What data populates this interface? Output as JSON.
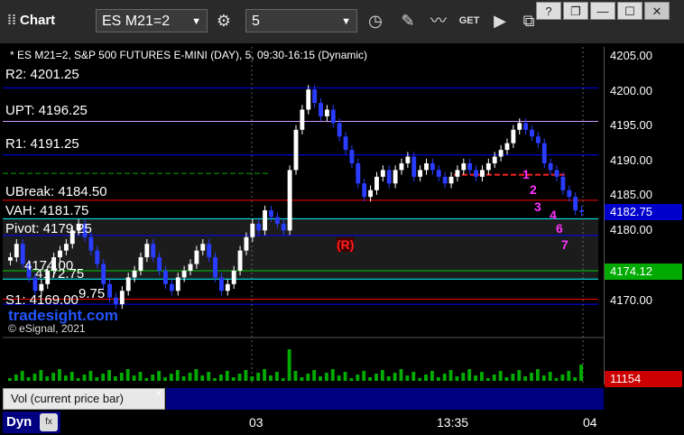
{
  "toolbar": {
    "app_title": "Chart",
    "symbol": "ES M21=2",
    "interval": "5",
    "win_help": "?",
    "win_restore": "❐",
    "win_minimize": "—",
    "win_maximize": "☐",
    "win_close": "✕"
  },
  "chart": {
    "header": "* ES M21=2, S&P 500 FUTURES E-MINI (DAY), 5, 09:30-16:15 (Dynamic)",
    "levels": [
      {
        "label": "R2: 4201.25",
        "color": "#0000ff"
      },
      {
        "label": "UPT: 4196.25",
        "color": "#cc99ff"
      },
      {
        "label": "R1: 4191.25",
        "color": "#0000ff"
      },
      {
        "label": "UBreak: 4184.50",
        "color": "#ff0000"
      },
      {
        "label": "VAH: 4181.75",
        "color": "#00ffff"
      },
      {
        "label": "Pivot: 4179.25",
        "color": "#0000ff"
      },
      {
        "label": "4174.00",
        "color": "#00cc00"
      },
      {
        "label": "4172.75",
        "color": "#00ffff"
      },
      {
        "label": "9.75",
        "color": "#ff0000"
      },
      {
        "label": "S1: 4169.00",
        "color": "#0000ff"
      }
    ],
    "brand": "tradesight.com",
    "copyright": "© eSignal, 2021",
    "r_marker": "(R)",
    "seq_magenta": [
      "1",
      "2",
      "3",
      "4",
      "6",
      "7"
    ]
  },
  "axis": {
    "ticks": [
      "4205.00",
      "4200.00",
      "4195.00",
      "4190.00",
      "4185.00",
      "4180.00",
      "4170.00"
    ],
    "last_price": "4182.75",
    "green_price": "4174.12",
    "volume": "11154"
  },
  "volume_panel": {
    "label": "Vol (current price bar)",
    "close": "×"
  },
  "bottom": {
    "dyn": "Dyn",
    "times": [
      "03",
      "13:35",
      "04"
    ]
  },
  "colors": {
    "up_bar": "#ffffff",
    "down_bar": "#2a3cff",
    "green": "#00cc00",
    "magenta": "#ff33ff"
  },
  "chart_data": {
    "type": "candlestick",
    "title": "* ES M21=2, S&P 500 FUTURES E-MINI (DAY), 5, 09:30-16:15 (Dynamic)",
    "ylim": [
      4167,
      4206
    ],
    "close_series": [
      4176,
      4178,
      4175,
      4173,
      4171,
      4172,
      4174,
      4176,
      4177,
      4178,
      4180,
      4181,
      4179,
      4177,
      4175,
      4172,
      4170,
      4169,
      4171,
      4173,
      4174,
      4176,
      4178,
      4176,
      4174,
      4172,
      4171,
      4173,
      4174,
      4175,
      4177,
      4178,
      4176,
      4173,
      4171,
      4172,
      4174,
      4177,
      4179,
      4181,
      4180,
      4183,
      4182,
      4181,
      4180,
      4189,
      4195,
      4198,
      4201,
      4199,
      4197,
      4198,
      4196,
      4194,
      4192,
      4190,
      4187,
      4185,
      4186,
      4188,
      4189,
      4187,
      4189,
      4190,
      4191,
      4188,
      4189,
      4190,
      4189,
      4188,
      4187,
      4188,
      4189,
      4190,
      4189,
      4188,
      4189,
      4190,
      4191,
      4192,
      4193,
      4195,
      4196,
      4195,
      4194,
      4193,
      4190,
      4189,
      4188,
      4186,
      4185,
      4183,
      4182.75
    ],
    "levels": [
      4201.25,
      4196.25,
      4191.25,
      4184.5,
      4181.75,
      4179.25,
      4174.0,
      4172.75,
      4169.75,
      4169.0
    ]
  }
}
